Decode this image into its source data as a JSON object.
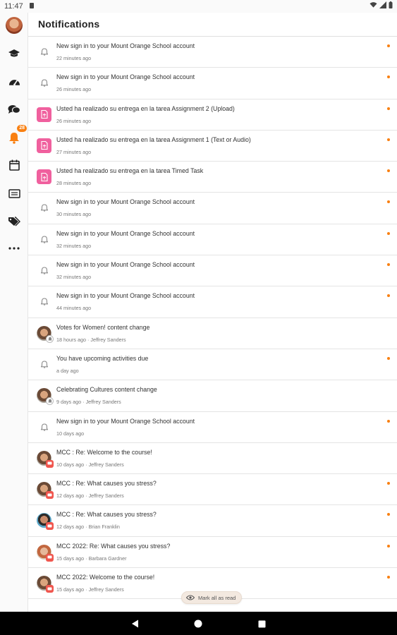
{
  "status_bar": {
    "time": "11:47"
  },
  "header": {
    "title": "Notifications"
  },
  "rail": {
    "notifications_badge": "28"
  },
  "notifications": [
    {
      "type": "system",
      "title": "New sign in to your Mount Orange School account",
      "time": "22 minutes ago",
      "author": "",
      "unread": true
    },
    {
      "type": "system",
      "title": "New sign in to your Mount Orange School account",
      "time": "26 minutes ago",
      "author": "",
      "unread": true
    },
    {
      "type": "assign",
      "title": "Usted ha realizado su entrega en la tarea Assignment 2 (Upload)",
      "time": "26 minutes ago",
      "author": "",
      "unread": true
    },
    {
      "type": "assign",
      "title": "Usted ha realizado su entrega en la tarea Assignment 1 (Text or Audio)",
      "time": "27 minutes ago",
      "author": "",
      "unread": true
    },
    {
      "type": "assign",
      "title": "Usted ha realizado su entrega en la tarea Timed Task",
      "time": "28 minutes ago",
      "author": "",
      "unread": true
    },
    {
      "type": "system",
      "title": "New sign in to your Mount Orange School account",
      "time": "30 minutes ago",
      "author": "",
      "unread": true
    },
    {
      "type": "system",
      "title": "New sign in to your Mount Orange School account",
      "time": "32 minutes ago",
      "author": "",
      "unread": true
    },
    {
      "type": "system",
      "title": "New sign in to your Mount Orange School account",
      "time": "32 minutes ago",
      "author": "",
      "unread": true
    },
    {
      "type": "system",
      "title": "New sign in to your Mount Orange School account",
      "time": "44 minutes ago",
      "author": "",
      "unread": true
    },
    {
      "type": "user-system",
      "title": "Votes for Women! content change",
      "time": "18 hours ago",
      "author": "Jeffrey Sanders",
      "unread": false,
      "avatar": "jeffrey"
    },
    {
      "type": "system",
      "title": "You have upcoming activities due",
      "time": "a day ago",
      "author": "",
      "unread": true
    },
    {
      "type": "user-system",
      "title": "Celebrating Cultures content change",
      "time": "9 days ago",
      "author": "Jeffrey Sanders",
      "unread": false,
      "avatar": "jeffrey"
    },
    {
      "type": "system",
      "title": "New sign in to your Mount Orange School account",
      "time": "10 days ago",
      "author": "",
      "unread": true
    },
    {
      "type": "user-forum",
      "title": "MCC : Re: Welcome to the course!",
      "time": "10 days ago",
      "author": "Jeffrey Sanders",
      "unread": false,
      "avatar": "jeffrey"
    },
    {
      "type": "user-forum",
      "title": "MCC : Re: What causes you stress?",
      "time": "12 days ago",
      "author": "Jeffrey Sanders",
      "unread": true,
      "avatar": "jeffrey"
    },
    {
      "type": "user-forum",
      "title": "MCC : Re: What causes you stress?",
      "time": "12 days ago",
      "author": "Brian Franklin",
      "unread": true,
      "avatar": "brian"
    },
    {
      "type": "user-forum",
      "title": "MCC 2022: Re: What causes you stress?",
      "time": "15 days ago",
      "author": "Barbara Gardner",
      "unread": true,
      "avatar": "barbara"
    },
    {
      "type": "user-forum",
      "title": "MCC 2022: Welcome to the course!",
      "time": "15 days ago",
      "author": "Jeffrey Sanders",
      "unread": true,
      "avatar": "jeffrey"
    }
  ],
  "mark_all": {
    "label": "Mark all as read"
  },
  "colors": {
    "accent": "#f98012",
    "assign": "#f0609e",
    "forum": "#f0564e"
  }
}
